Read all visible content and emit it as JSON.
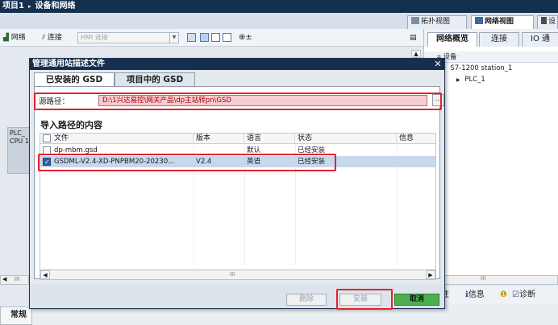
{
  "breadcrumb": {
    "project": "项目1",
    "separator": "▸",
    "section": "设备和网络"
  },
  "view_tabs": [
    {
      "label": "拓扑视图"
    },
    {
      "label": "网络视图"
    },
    {
      "label": "设"
    }
  ],
  "toolbar": {
    "network_label": "网络",
    "connection_label": "连接",
    "hmi_placeholder": "HMI 连接"
  },
  "canvas": {
    "plc_name": "PLC_",
    "plc_cpu": "CPU 1"
  },
  "right_panel": {
    "tabs": [
      {
        "label": "网络概览"
      },
      {
        "label": "连接"
      },
      {
        "label": "IO 通"
      }
    ],
    "tree_header": "设备",
    "tree": [
      {
        "label": "S7-1200 station_1"
      },
      {
        "label": "PLC_1"
      }
    ],
    "bottom": {
      "properties": "性",
      "info": "信息",
      "diag": "诊断"
    }
  },
  "bottom_tab": "常规",
  "dialog": {
    "title": "管理通用站描述文件",
    "tabs": [
      {
        "label": "已安装的 GSD"
      },
      {
        "label": "项目中的 GSD"
      }
    ],
    "source_label": "源路径：",
    "source_path": "D:\\1兴达易控\\网关产品\\dp主站转pn\\GSD",
    "browse": "...",
    "section_title": "导入路径的内容",
    "columns": [
      "文件",
      "版本",
      "语言",
      "状态",
      "信息"
    ],
    "rows": [
      {
        "file": "dp-mbm.gsd",
        "version": "",
        "language": "默认",
        "status": "已经安装",
        "info": "",
        "checked": false,
        "selected": false
      },
      {
        "file": "GSDML-V2.4-XD-PNPBM20-20230...",
        "version": "V2.4",
        "language": "英语",
        "status": "已经安装",
        "info": "",
        "checked": true,
        "selected": true
      }
    ],
    "scroll_mid": "III",
    "buttons": {
      "delete": "删除",
      "install": "安装",
      "cancel": "取消"
    }
  }
}
